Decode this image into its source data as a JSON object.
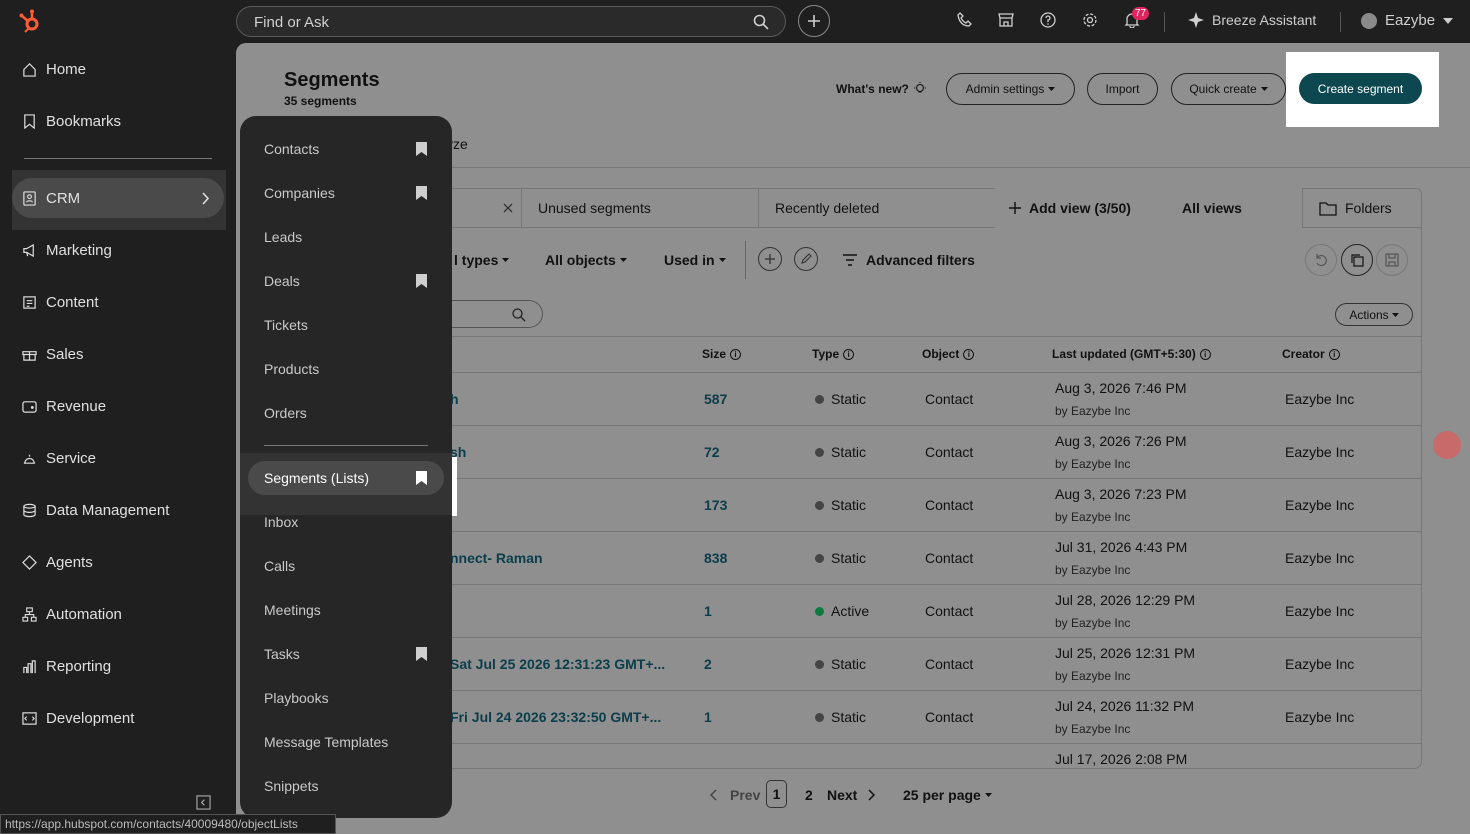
{
  "topbar": {
    "search_placeholder": "Find or Ask",
    "notifications_count": "77",
    "breeze_label": "Breeze Assistant",
    "account_label": "Eazybe"
  },
  "sidenav": {
    "items": [
      {
        "label": "Home",
        "icon": "home-icon"
      },
      {
        "label": "Bookmarks",
        "icon": "bookmark-icon"
      },
      {
        "label": "CRM",
        "icon": "crm-icon"
      },
      {
        "label": "Marketing",
        "icon": "megaphone-icon"
      },
      {
        "label": "Content",
        "icon": "content-icon"
      },
      {
        "label": "Sales",
        "icon": "sales-icon"
      },
      {
        "label": "Revenue",
        "icon": "revenue-icon"
      },
      {
        "label": "Service",
        "icon": "service-icon"
      },
      {
        "label": "Data Management",
        "icon": "database-icon"
      },
      {
        "label": "Agents",
        "icon": "agents-icon"
      },
      {
        "label": "Automation",
        "icon": "automation-icon"
      },
      {
        "label": "Reporting",
        "icon": "reporting-icon"
      },
      {
        "label": "Development",
        "icon": "development-icon"
      }
    ]
  },
  "crm_menu": {
    "items": [
      {
        "label": "Contacts",
        "bookmarked": true
      },
      {
        "label": "Companies",
        "bookmarked": true
      },
      {
        "label": "Leads",
        "bookmarked": false
      },
      {
        "label": "Deals",
        "bookmarked": true
      },
      {
        "label": "Tickets",
        "bookmarked": false
      },
      {
        "label": "Products",
        "bookmarked": false
      },
      {
        "label": "Orders",
        "bookmarked": false
      },
      {
        "label": "Segments (Lists)",
        "bookmarked": true,
        "selected": true
      },
      {
        "label": "Inbox",
        "bookmarked": false
      },
      {
        "label": "Calls",
        "bookmarked": false
      },
      {
        "label": "Meetings",
        "bookmarked": false
      },
      {
        "label": "Tasks",
        "bookmarked": true
      },
      {
        "label": "Playbooks",
        "bookmarked": false
      },
      {
        "label": "Message Templates",
        "bookmarked": false
      },
      {
        "label": "Snippets",
        "bookmarked": false
      }
    ]
  },
  "page": {
    "title": "Segments",
    "subtitle": "35 segments",
    "whats_new": "What's new?",
    "admin_settings": "Admin settings",
    "import": "Import",
    "quick_create": "Quick create",
    "create_segment": "Create segment",
    "tab_partial": "yze"
  },
  "views": {
    "unused": "Unused segments",
    "deleted": "Recently deleted",
    "add_view": "Add view (3/50)",
    "all_views": "All views",
    "folders": "Folders"
  },
  "filters": {
    "types": "l types",
    "objects": "All objects",
    "used_in": "Used in",
    "advanced": "Advanced filters",
    "actions": "Actions"
  },
  "table": {
    "headers": {
      "size": "Size",
      "type": "Type",
      "object": "Object",
      "last_updated": "Last updated (GMT+5:30)",
      "creator": "Creator"
    },
    "rows": [
      {
        "name": "h",
        "size": "587",
        "type": "Static",
        "object": "Contact",
        "date": "Aug 3, 2026 7:46 PM",
        "by": "by Eazybe Inc",
        "creator": "Eazybe Inc"
      },
      {
        "name": "sh",
        "size": "72",
        "type": "Static",
        "object": "Contact",
        "date": "Aug 3, 2026 7:26 PM",
        "by": "by Eazybe Inc",
        "creator": "Eazybe Inc"
      },
      {
        "name": "",
        "size": "173",
        "type": "Static",
        "object": "Contact",
        "date": "Aug 3, 2026 7:23 PM",
        "by": "by Eazybe Inc",
        "creator": "Eazybe Inc"
      },
      {
        "name": "nnect- Raman",
        "size": "838",
        "type": "Static",
        "object": "Contact",
        "date": "Jul 31, 2026 4:43 PM",
        "by": "by Eazybe Inc",
        "creator": "Eazybe Inc"
      },
      {
        "name": "",
        "size": "1",
        "type": "Active",
        "object": "Contact",
        "date": "Jul 28, 2026 12:29 PM",
        "by": "by Eazybe Inc",
        "creator": "Eazybe Inc"
      },
      {
        "name": "Sat Jul 25 2026 12:31:23 GMT+...",
        "size": "2",
        "type": "Static",
        "object": "Contact",
        "date": "Jul 25, 2026 12:31 PM",
        "by": "by Eazybe Inc",
        "creator": "Eazybe Inc"
      },
      {
        "name": "Fri Jul 24 2026 23:32:50 GMT+...",
        "size": "1",
        "type": "Static",
        "object": "Contact",
        "date": "Jul 24, 2026 11:32 PM",
        "by": "by Eazybe Inc",
        "creator": "Eazybe Inc"
      },
      {
        "name": "",
        "size": "",
        "type": "",
        "object": "",
        "date": "Jul 17, 2026 2:08 PM",
        "by": "",
        "creator": ""
      }
    ]
  },
  "pagination": {
    "prev": "Prev",
    "page1": "1",
    "page2": "2",
    "next": "Next",
    "per_page": "25 per page"
  },
  "status_url": "https://app.hubspot.com/contacts/40009480/objectLists"
}
